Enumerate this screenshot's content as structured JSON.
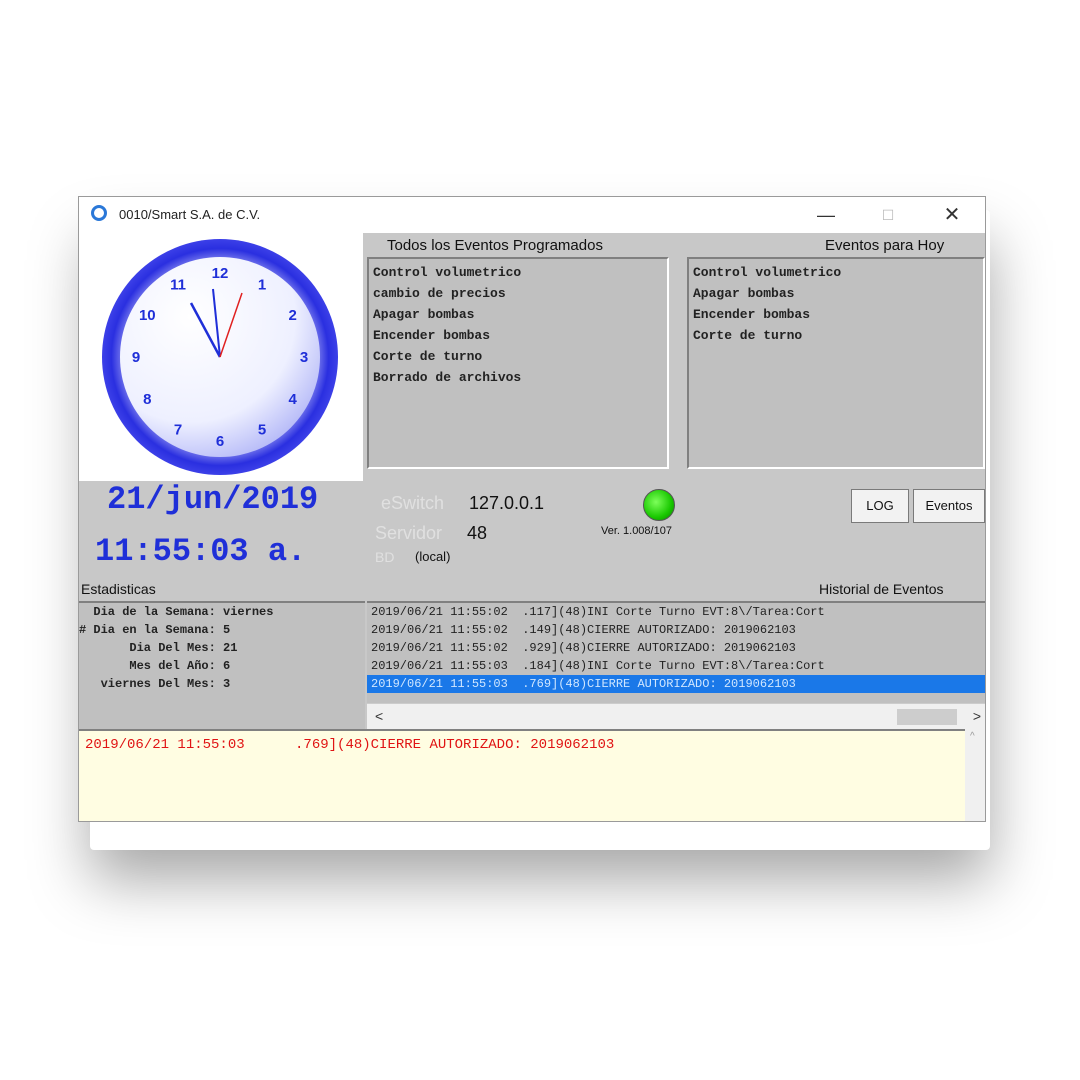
{
  "window": {
    "title": "0010/Smart S.A. de C.V.",
    "controls": {
      "minimize": "—",
      "maximize": "☐",
      "close": "✕"
    }
  },
  "clock": {
    "numbers": [
      "12",
      "1",
      "2",
      "3",
      "4",
      "5",
      "6",
      "7",
      "8",
      "9",
      "10",
      "11"
    ]
  },
  "events": {
    "all_label": "Todos los Eventos Programados",
    "all_items": [
      "Control volumetrico",
      "cambio de precios",
      "Apagar bombas",
      "Encender bombas",
      "Corte de turno",
      "Borrado de archivos"
    ],
    "today_label": "Eventos para Hoy",
    "today_items": [
      "Control volumetrico",
      "Apagar bombas",
      "Encender bombas",
      "Corte de turno"
    ]
  },
  "datetime": {
    "date": "21/jun/2019",
    "time": "11:55:03 a."
  },
  "connection": {
    "eswitch_label": "eSwitch",
    "eswitch_value": "127.0.0.1",
    "server_label": "Servidor",
    "server_value": "48",
    "bd_label": "BD",
    "bd_value": "(local)",
    "version": "Ver. 1.008/107"
  },
  "buttons": {
    "log": "LOG",
    "events": "Eventos"
  },
  "stats": {
    "label": "Estadisticas",
    "lines": [
      "  Dia de la Semana: viernes",
      "# Dia en la Semana: 5",
      "       Dia Del Mes: 21",
      "       Mes del Año: 6",
      "   viernes Del Mes: 3"
    ]
  },
  "history": {
    "label": "Historial de Eventos",
    "rows": [
      "2019/06/21 11:55:02  .117](48)INI Corte Turno EVT:8\\/Tarea:Cort",
      "2019/06/21 11:55:02  .149](48)CIERRE AUTORIZADO: 2019062103",
      "2019/06/21 11:55:02  .929](48)CIERRE AUTORIZADO: 2019062103",
      "2019/06/21 11:55:03  .184](48)INI Corte Turno EVT:8\\/Tarea:Cort",
      "2019/06/21 11:55:03  .769](48)CIERRE AUTORIZADO: 2019062103"
    ],
    "selected_index": 4
  },
  "log": {
    "line": "2019/06/21 11:55:03      .769](48)CIERRE AUTORIZADO: 2019062103"
  },
  "colors": {
    "accent": "#1f2fd8",
    "led": "#19c800",
    "log_text": "#e01414",
    "selection": "#1a78e8"
  }
}
